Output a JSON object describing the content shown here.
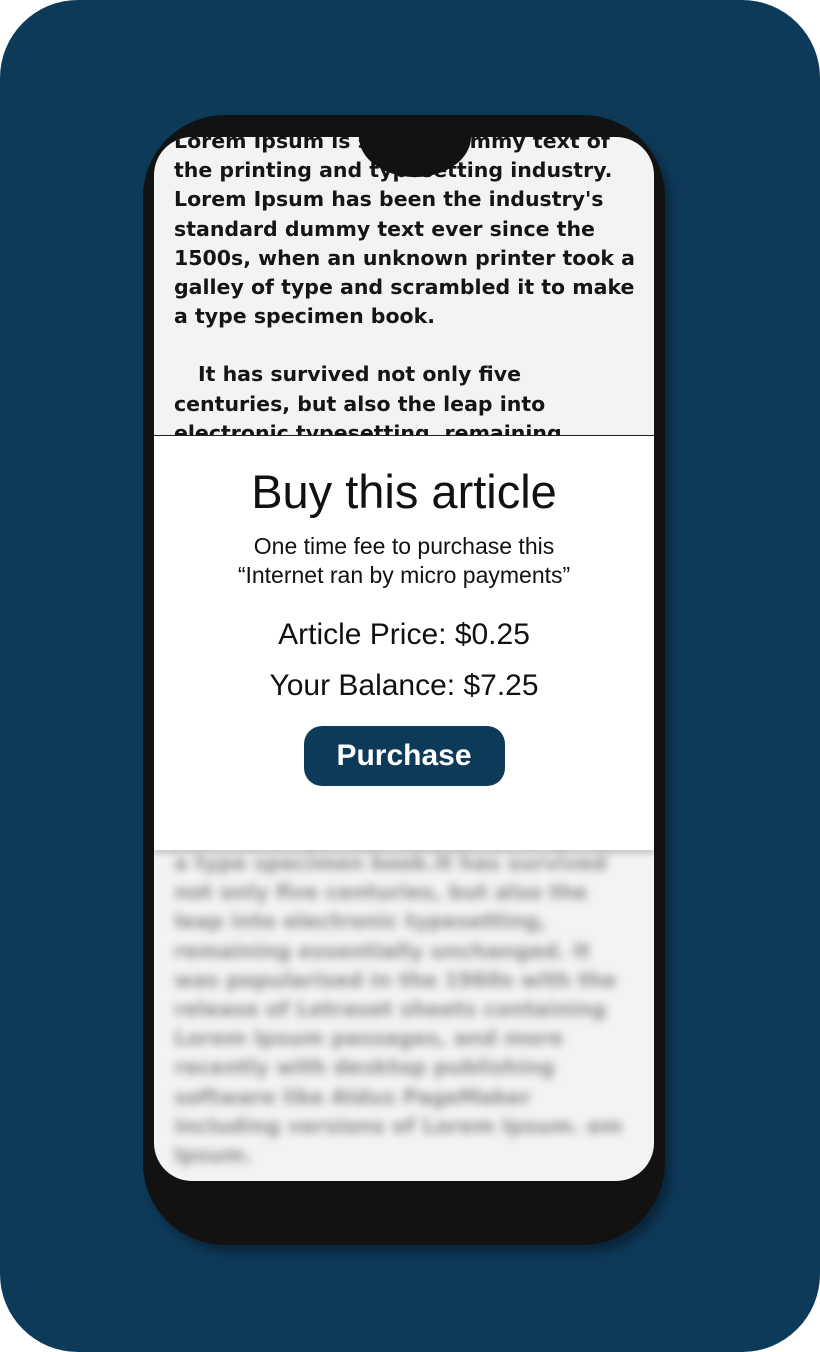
{
  "colors": {
    "background": "#0e3a5a",
    "phone_body": "#121212",
    "screen": "#f3f3f3",
    "button": "#0e3a5a",
    "button_text": "#ffffff"
  },
  "article": {
    "paragraph1": "Lorem Ipsum is simply dummy text of the printing and typesetting industry. Lorem Ipsum has been the industry's standard dummy text ever since the 1500s, when an unknown printer took a galley of type and scrambled it to make a type specimen book.",
    "paragraph2": "It has survived not only five centuries, but also the leap into electronic typesetting, remaining",
    "blurred_text": "a type specimen book.It has survived not only five centuries, but also the leap into electronic typesetting, remaining essentially unchanged. It was popularised in the 1960s with the release of Letraset sheets containing Lorem Ipsum passages, and more recently with desktop publishing software like Aldus PageMaker including versions of Lorem Ipsum. em Ipsum."
  },
  "paywall": {
    "title": "Buy this article",
    "subtitle_line1": "One time fee to purchase this",
    "subtitle_line2": "“Internet ran by micro payments”",
    "price": "Article Price: $0.25",
    "balance": "Your Balance: $7.25",
    "purchase_label": "Purchase"
  }
}
